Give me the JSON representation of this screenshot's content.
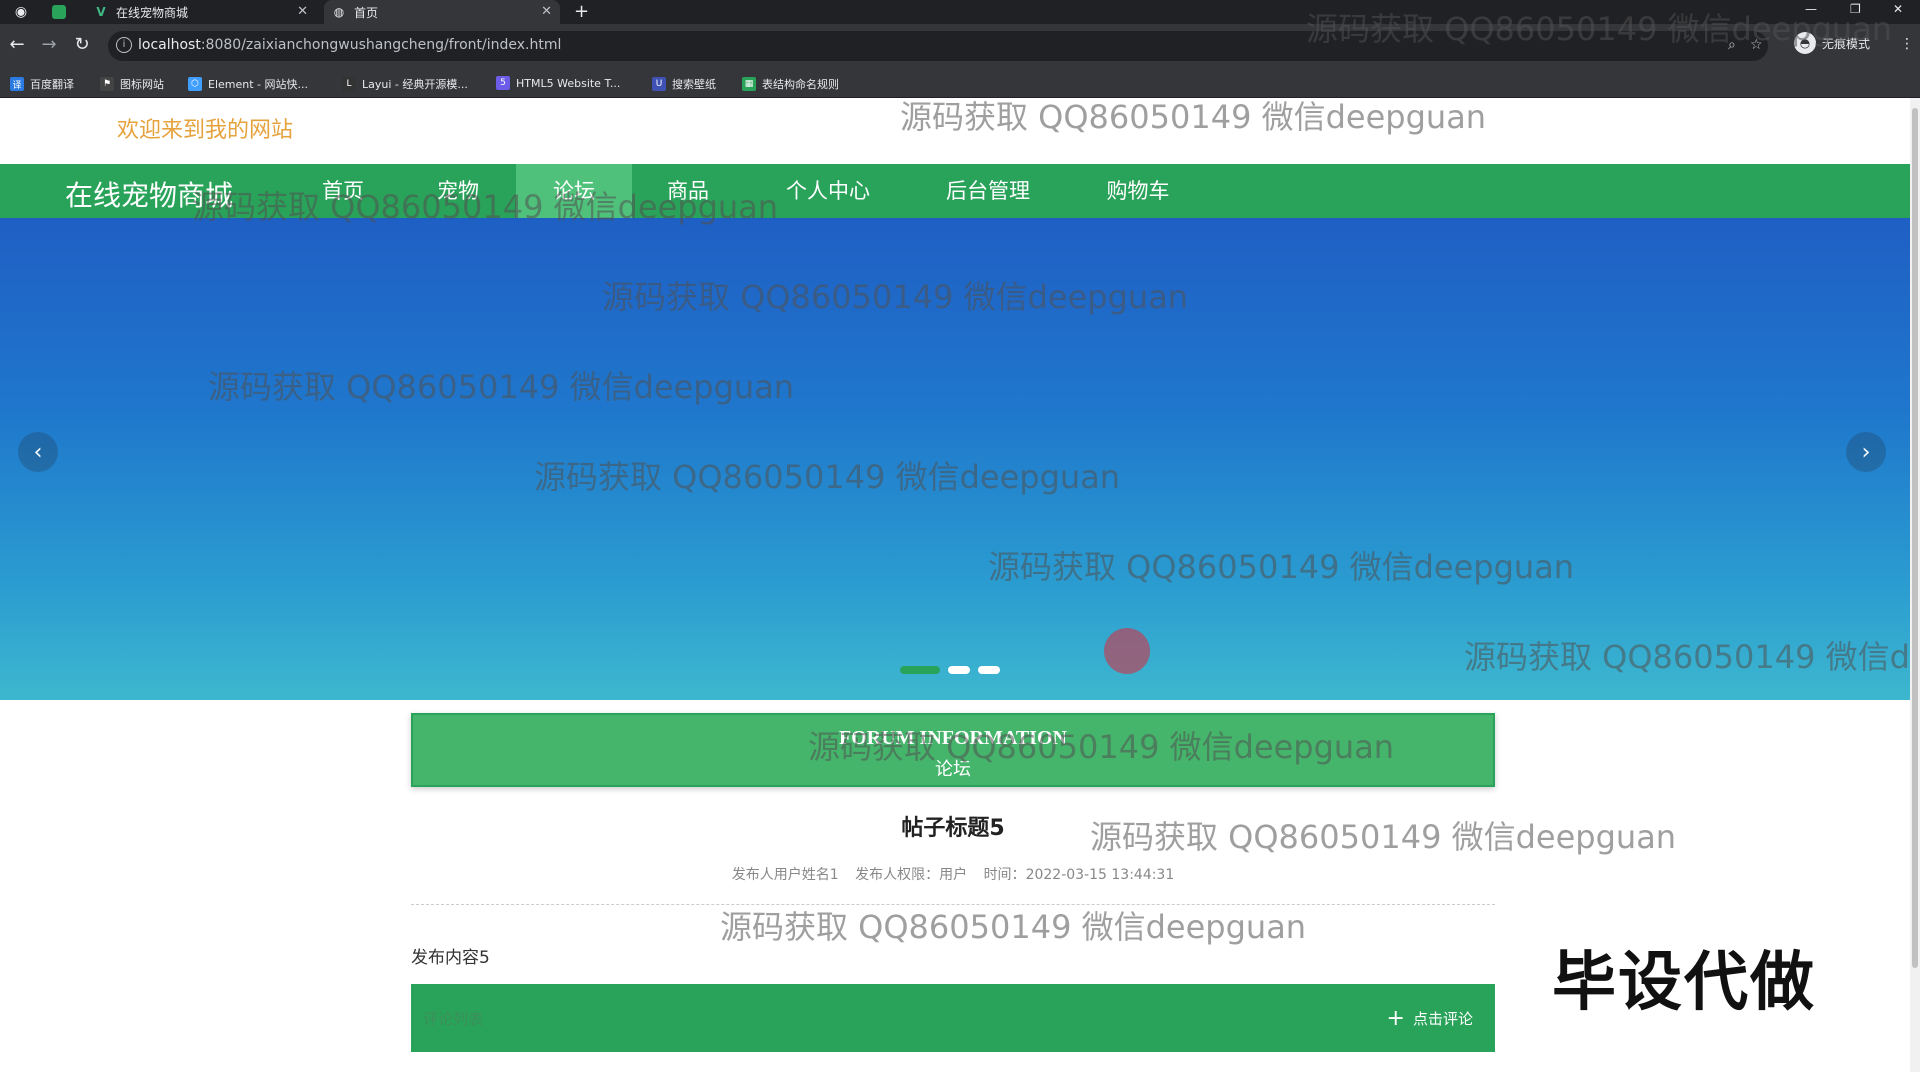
{
  "browser": {
    "tabs": [
      {
        "title": "在线宠物商城",
        "active": false
      },
      {
        "title": "首页",
        "active": true
      }
    ],
    "new_tab_symbol": "+",
    "url_host": "localhost",
    "url_rest": ":8080/zaixianchongwushangcheng/front/index.html",
    "profile_label": "无痕模式",
    "bookmarks": [
      {
        "label": "百度翻译",
        "color": "#2a7ae2"
      },
      {
        "label": "图标网站",
        "color": "#444444"
      },
      {
        "label": "Element - 网站快...",
        "color": "#409eff"
      },
      {
        "label": "Layui - 经典开源模...",
        "color": "#333333"
      },
      {
        "label": "HTML5 Website T...",
        "color": "#6c5ce7"
      },
      {
        "label": "搜索壁纸",
        "color": "#3f51b5"
      },
      {
        "label": "表结构命名规则",
        "color": "#2aa35a"
      }
    ]
  },
  "site": {
    "welcome": "欢迎来到我的网站",
    "brand": "在线宠物商城",
    "nav": [
      {
        "label": "首页",
        "active": false
      },
      {
        "label": "宠物",
        "active": false
      },
      {
        "label": "论坛",
        "active": true
      },
      {
        "label": "商品",
        "active": false
      },
      {
        "label": "个人中心",
        "active": false
      },
      {
        "label": "后台管理",
        "active": false
      },
      {
        "label": "购物车",
        "active": false
      }
    ],
    "carousel": {
      "slide_count": 3,
      "active_index": 0
    },
    "section": {
      "en": "FORUM INFORMATION",
      "cn": "论坛"
    },
    "post": {
      "title": "帖子标题5",
      "author_label": "发布人用户姓名1",
      "role_label": "发布人权限：用户",
      "time_label": "时间：",
      "time_value": "2022-03-15 13:44:31",
      "content": "发布内容5"
    },
    "comments": {
      "label": "评论列表",
      "button": "点击评论"
    }
  },
  "overlay": {
    "watermark": "源码获取 QQ86050149 微信deepguan",
    "stamp": "毕设代做"
  },
  "colors": {
    "primary": "#2aa35a",
    "welcome": "#e6a23c",
    "banner_top": "#1f5fc4",
    "banner_bottom": "#3db7cf"
  }
}
